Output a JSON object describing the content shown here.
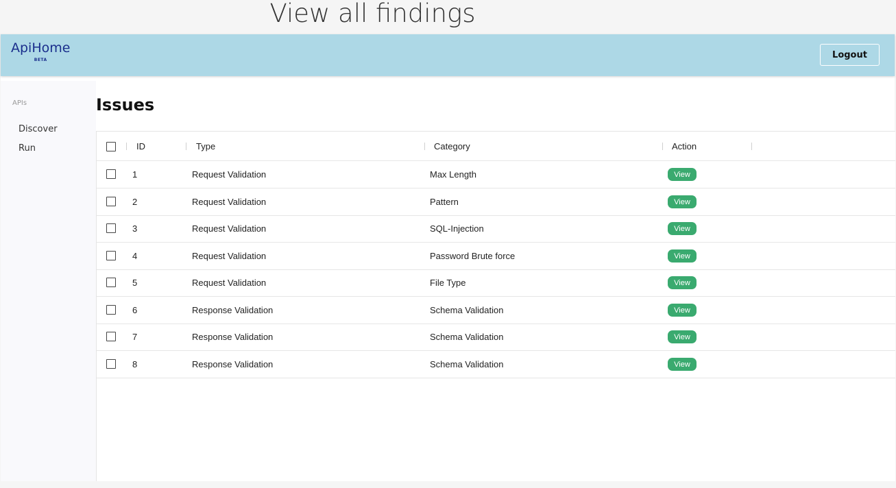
{
  "caption": "View all findings",
  "header": {
    "brand": "ApiHome",
    "beta": "BETA",
    "logout_label": "Logout"
  },
  "sidebar": {
    "heading": "APIs",
    "items": [
      {
        "label": "Discover"
      },
      {
        "label": "Run"
      }
    ]
  },
  "main": {
    "title": "Issues",
    "table": {
      "columns": [
        "ID",
        "Type",
        "Category",
        "Action"
      ],
      "rows": [
        {
          "id": "1",
          "type": "Request Validation",
          "category": "Max Length",
          "action": "View"
        },
        {
          "id": "2",
          "type": "Request Validation",
          "category": "Pattern",
          "action": "View"
        },
        {
          "id": "3",
          "type": "Request Validation",
          "category": "SQL-Injection",
          "action": "View"
        },
        {
          "id": "4",
          "type": "Request Validation",
          "category": "Password Brute force",
          "action": "View"
        },
        {
          "id": "5",
          "type": "Request Validation",
          "category": "File Type",
          "action": "View"
        },
        {
          "id": "6",
          "type": "Response Validation",
          "category": "Schema Validation",
          "action": "View"
        },
        {
          "id": "7",
          "type": "Response Validation",
          "category": "Schema Validation",
          "action": "View"
        },
        {
          "id": "8",
          "type": "Response Validation",
          "category": "Schema Validation",
          "action": "View"
        }
      ]
    }
  },
  "colors": {
    "header_bg": "#add8e6",
    "brand": "#1a2e8c",
    "view_button": "#3aaa6f"
  }
}
